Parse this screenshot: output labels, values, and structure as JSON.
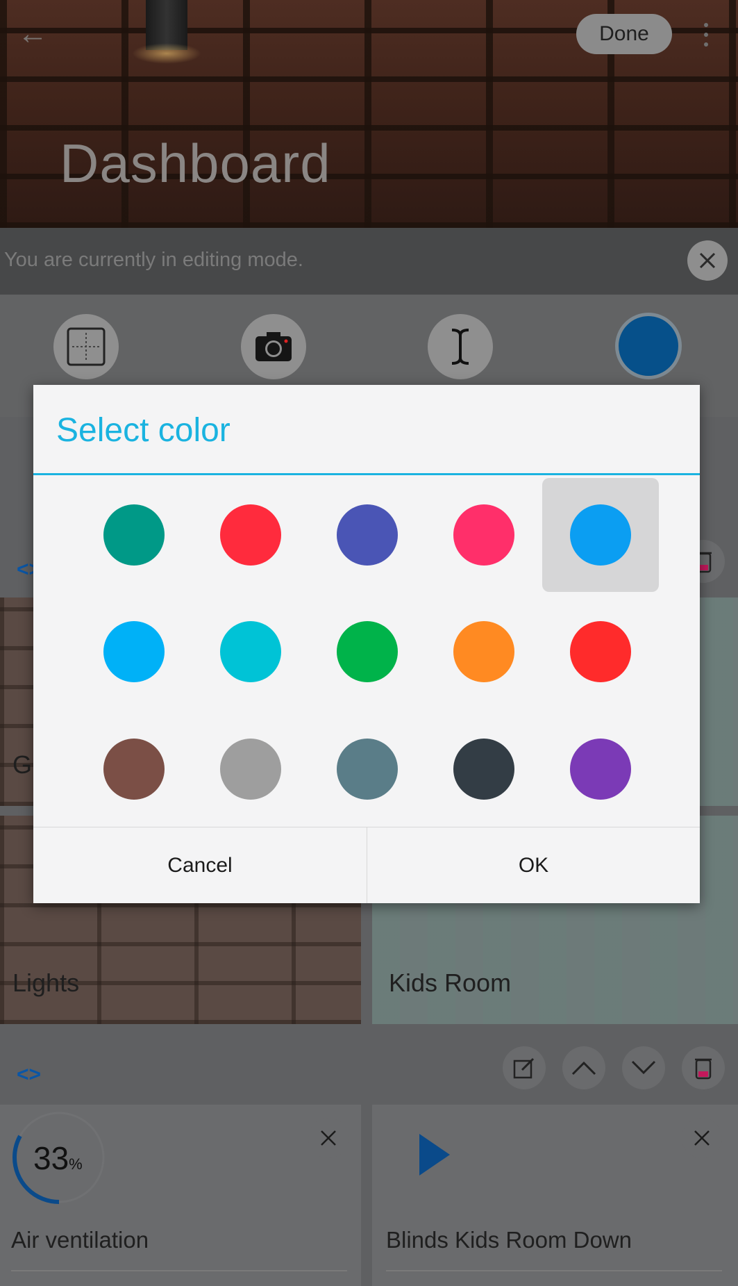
{
  "header": {
    "back_icon": "arrow-left-icon",
    "done_label": "Done",
    "more_icon": "more-vertical-icon",
    "title": "Dashboard"
  },
  "edit_bar": {
    "message": "You are currently in editing mode.",
    "close_icon": "close-icon"
  },
  "tools": [
    {
      "name": "grid-layout-icon"
    },
    {
      "name": "camera-icon"
    },
    {
      "name": "text-cursor-icon"
    },
    {
      "name": "color-picker",
      "color": "#06508a"
    }
  ],
  "tiles": {
    "row1": {
      "left_label_partial": "G",
      "code_tag": "<>"
    },
    "row2": {
      "left_label": "Lights",
      "right_label": "Kids Room"
    },
    "row3": {
      "code_tag": "<>",
      "left_value": "33",
      "left_unit": "%",
      "left_progress": 0.33,
      "left_label": "Air ventilation",
      "right_label": "Blinds Kids Room Down"
    }
  },
  "dialog": {
    "title": "Select color",
    "accent": "#1ab3e0",
    "swatches": [
      [
        "#009987",
        "#ff2b3d",
        "#4a55b5",
        "#ff2f6a",
        "#0b9ef2"
      ],
      [
        "#00b1f7",
        "#00c3d6",
        "#00b34a",
        "#ff8a22",
        "#ff2b2b"
      ],
      [
        "#7b4f46",
        "#9e9e9e",
        "#5a7d88",
        "#333d45",
        "#7b3ab6"
      ]
    ],
    "selected": {
      "row": 0,
      "col": 4
    },
    "cancel_label": "Cancel",
    "ok_label": "OK"
  }
}
